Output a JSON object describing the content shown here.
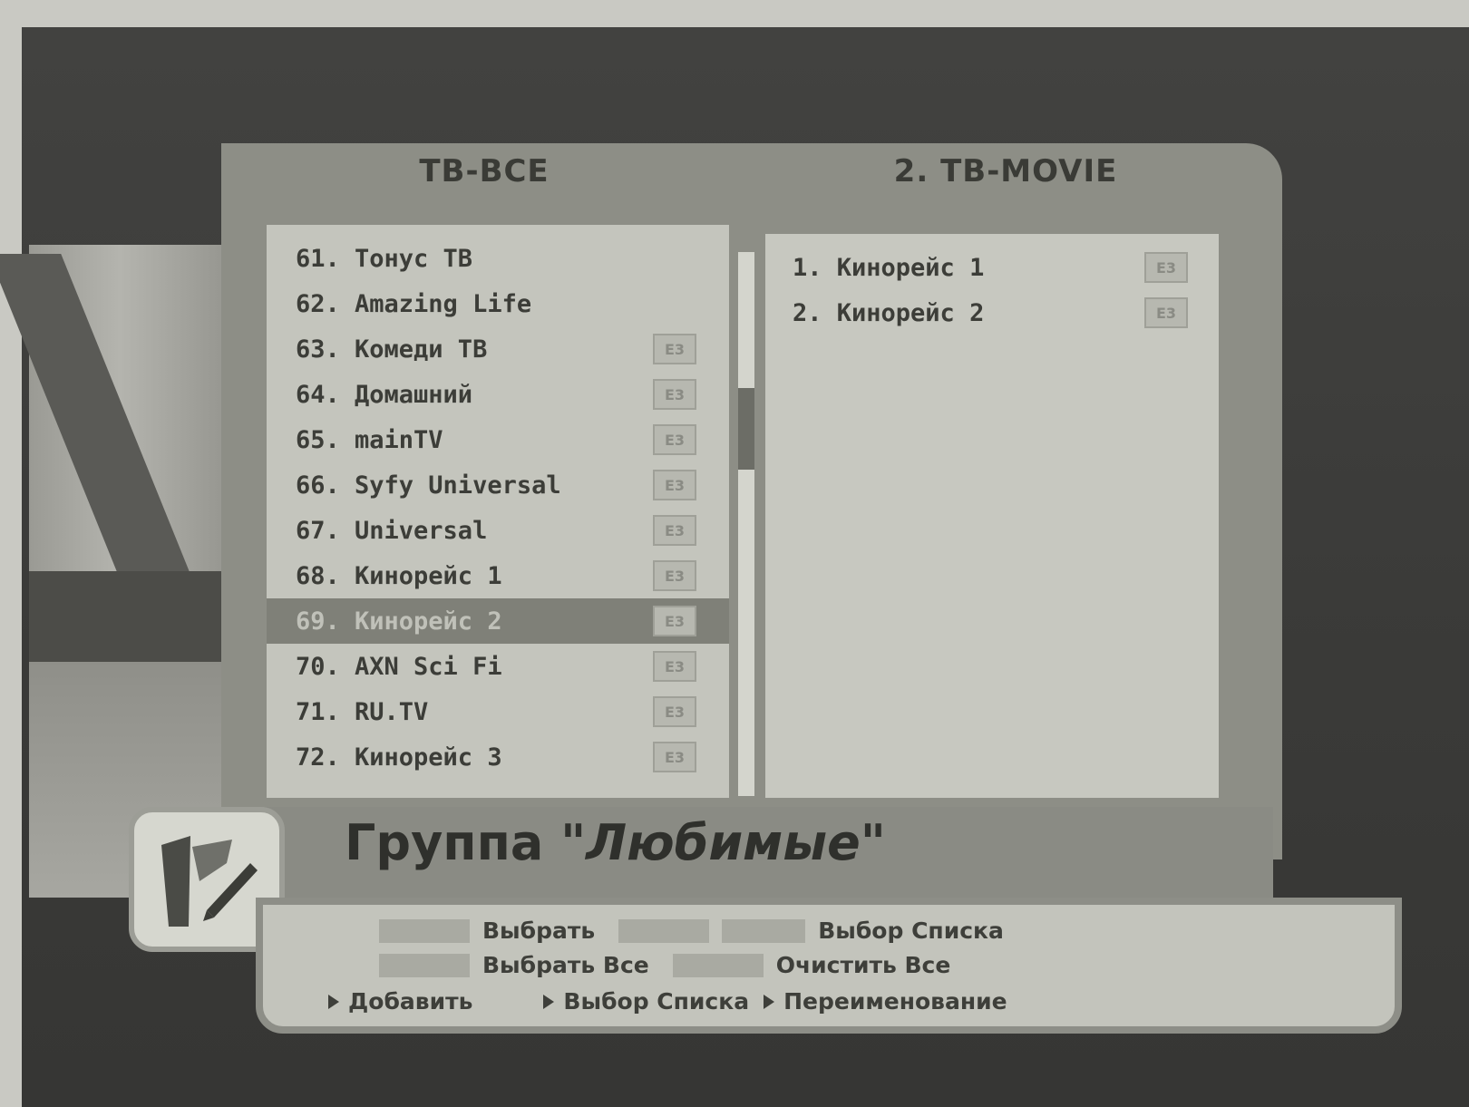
{
  "left_panel": {
    "title": "ТВ-ВСЕ",
    "channels": [
      {
        "label": "61. Тонус ТВ",
        "badge": ""
      },
      {
        "label": "62. Amazing Life",
        "badge": ""
      },
      {
        "label": "63. Комеди ТВ",
        "badge": "E3"
      },
      {
        "label": "64. Домашний",
        "badge": "E3"
      },
      {
        "label": "65. mainTV",
        "badge": "E3"
      },
      {
        "label": "66. Syfy Universal",
        "badge": "E3"
      },
      {
        "label": "67. Universal",
        "badge": "E3"
      },
      {
        "label": "68. Кинорейс 1",
        "badge": "E3"
      },
      {
        "label": "69. Кинорейс 2",
        "badge": "E3",
        "selected": true
      },
      {
        "label": "70. AXN Sci Fi",
        "badge": "E3"
      },
      {
        "label": "71. RU.TV",
        "badge": "E3"
      },
      {
        "label": "72. Кинорейс 3",
        "badge": "E3"
      }
    ]
  },
  "right_panel": {
    "title": "2. ТВ-MOVIE",
    "channels": [
      {
        "label": "1. Кинорейс 1",
        "badge": "E3"
      },
      {
        "label": "2. Кинорейс 2",
        "badge": "E3"
      }
    ]
  },
  "group": {
    "prefix": "Группа",
    "name": "\"Любимые\""
  },
  "help": {
    "select": "Выбрать",
    "select_list": "Выбор Списка",
    "select_all": "Выбрать Все",
    "clear_all": "Очистить Все",
    "add": "Добавить",
    "choose_list": "Выбор Списка",
    "rename": "Переименование"
  },
  "colors": {
    "panel": "#8d8e86",
    "list_bg": "#c4c5bd",
    "selected_row": "#7f8078",
    "text": "#3c3d38"
  }
}
